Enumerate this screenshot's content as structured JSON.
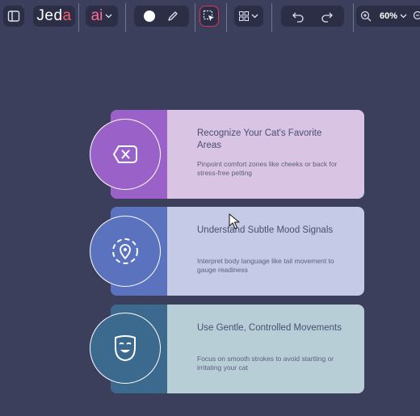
{
  "toolbar": {
    "brand": {
      "main": "Jed",
      "accent": "a"
    },
    "ai_label": "ai",
    "zoom_label": "60%"
  },
  "steps": [
    {
      "title": "Recognize Your Cat's Favorite Areas",
      "description": "Pinpoint comfort zones like cheeks or back for stress-free petting",
      "icon": "tag-x-icon",
      "colors": {
        "card": "#d9c4e3",
        "band": "#9a62c8",
        "circle": "#9a62c8"
      }
    },
    {
      "title": "Understand Subtle Mood Signals",
      "description": "Interpret body language like tail movement to gauge readiness",
      "icon": "location-pin-icon",
      "colors": {
        "card": "#c5cae6",
        "band": "#5b72be",
        "circle": "#5b72be"
      }
    },
    {
      "title": "Use Gentle, Controlled Movements",
      "description": "Focus on smooth strokes to avoid startling or irritating your cat",
      "icon": "smiling-mask-icon",
      "colors": {
        "card": "#b8ced7",
        "band": "#3b6a8e",
        "circle": "#3b6a8e"
      }
    }
  ]
}
